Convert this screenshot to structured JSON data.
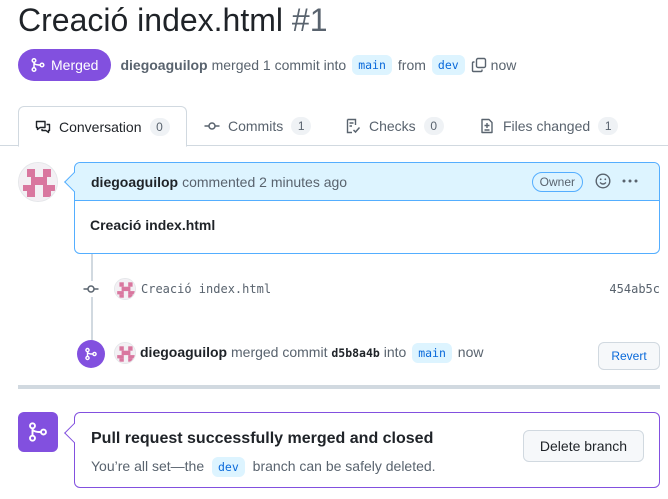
{
  "pr": {
    "title": "Creació index.html",
    "number": "#1",
    "state_label": "Merged",
    "author": "diegoaguilop",
    "summary_action": "merged 1 commit into",
    "base_branch": "main",
    "from_word": "from",
    "head_branch": "dev",
    "time": "now"
  },
  "tabs": [
    {
      "label": "Conversation",
      "count": "0",
      "icon": "comment-discussion-icon"
    },
    {
      "label": "Commits",
      "count": "1",
      "icon": "git-commit-icon"
    },
    {
      "label": "Checks",
      "count": "0",
      "icon": "checklist-icon"
    },
    {
      "label": "Files changed",
      "count": "1",
      "icon": "file-diff-icon"
    }
  ],
  "comment": {
    "author": "diegoaguilop",
    "action": "commented 2 minutes ago",
    "badge": "Owner",
    "body": "Creació index.html"
  },
  "commit": {
    "message": "Creació index.html",
    "sha": "454ab5c"
  },
  "merge_event": {
    "author": "diegoaguilop",
    "action": "merged commit",
    "sha": "d5b8a4b",
    "into_word": "into",
    "branch": "main",
    "time": "now",
    "revert_label": "Revert"
  },
  "status": {
    "title": "Pull request successfully merged and closed",
    "sub_prefix": "You’re all set—the",
    "branch": "dev",
    "sub_suffix": "branch can be safely deleted.",
    "delete_label": "Delete branch"
  },
  "colors": {
    "merged_purple": "#8250df",
    "link_blue": "#0969da",
    "comment_header_bg": "#ddf4ff",
    "avatar_pink": "#d9779f"
  }
}
